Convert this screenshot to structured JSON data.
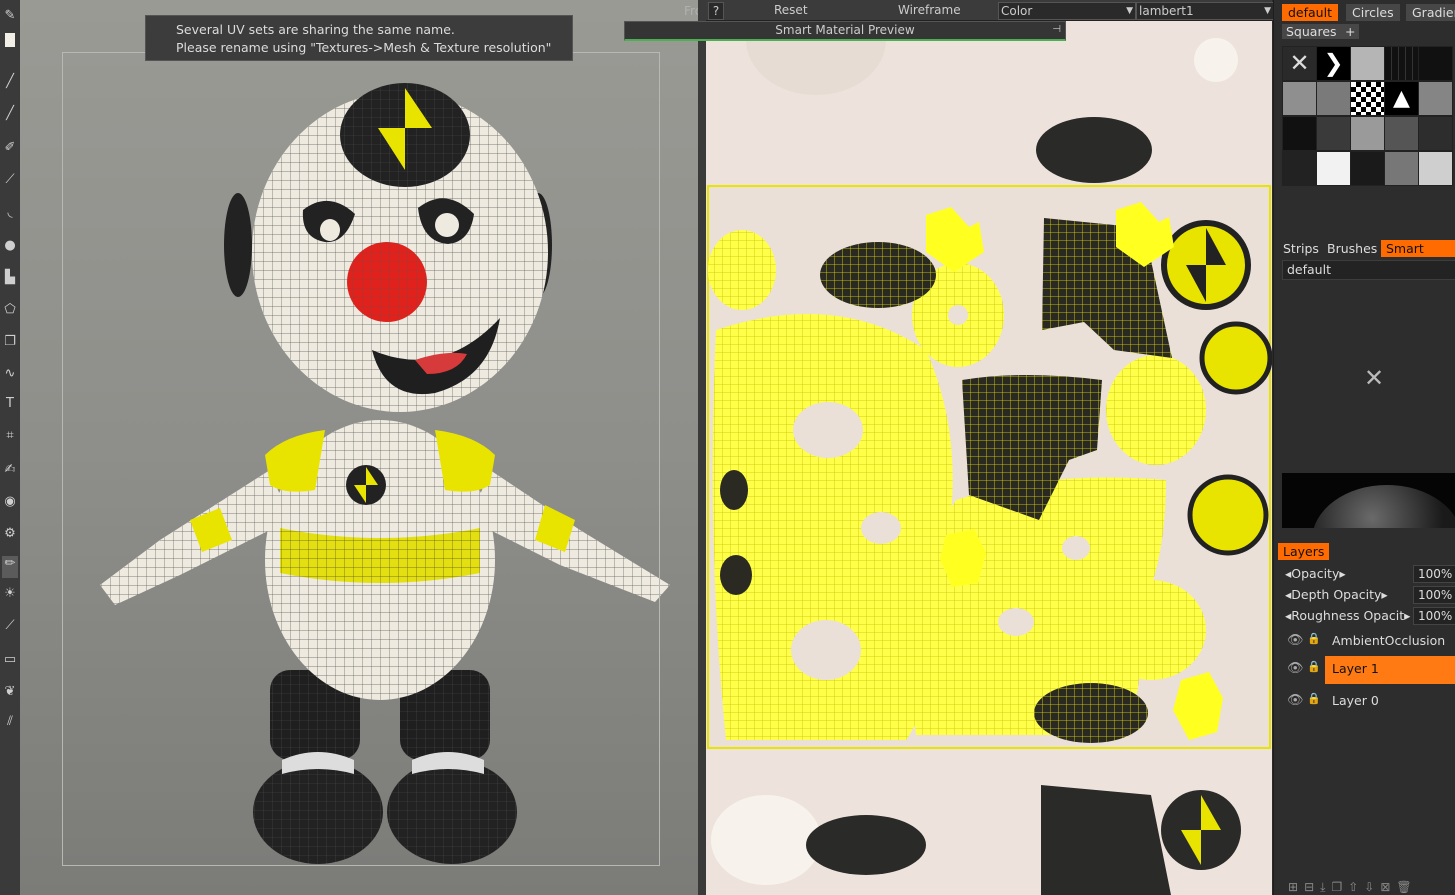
{
  "notification": {
    "line1": "Several UV sets are sharing the same name.",
    "line2": "Please rename using \"Textures->Mesh & Texture resolution\""
  },
  "viewport": {
    "view_label": "Front"
  },
  "uv_toolbar": {
    "help_label": "?",
    "reset_label": "Reset",
    "wireframe_label": "Wireframe",
    "channel_value": "Color",
    "material_value": "lambert1",
    "smart_material_preview_label": "Smart Material Preview"
  },
  "stencil_tabs": [
    "default",
    "Circles",
    "Gradien"
  ],
  "stencil_active": "default",
  "stencil_subset": "Squares",
  "stencil_add_label": "+",
  "browser_tabs": [
    "Strips",
    "Brushes",
    "Smart Mate"
  ],
  "browser_active": "Smart Mate",
  "smart_material_folder": "default",
  "layers": {
    "tab_label": "Layers",
    "properties": [
      {
        "label": "Opacity",
        "value": "100%"
      },
      {
        "label": "Depth Opacity",
        "value": "100%"
      },
      {
        "label": "Roughness Opacit",
        "value": "100%"
      }
    ],
    "items": [
      {
        "name": "AmbientOcclusion",
        "active": false
      },
      {
        "name": "Layer 1",
        "active": true
      },
      {
        "name": "Layer 0",
        "active": false
      }
    ]
  },
  "colors": {
    "accent": "#ff6b00",
    "uv_wire": "#ffff00",
    "panel_bg": "#2d2d2d",
    "viewport_bg": "#8e8e8a",
    "uv_bg": "#eee3dc"
  },
  "icons": {
    "brush": "brush-icon",
    "close": "close-icon",
    "eye": "eye-icon",
    "lock": "lock-icon"
  }
}
